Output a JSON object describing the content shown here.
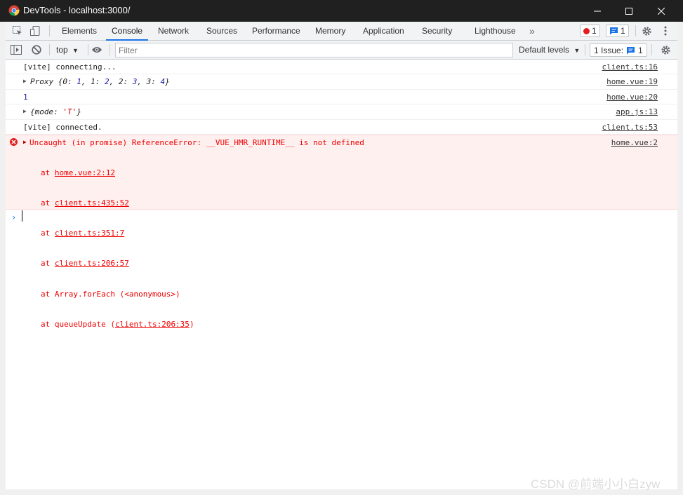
{
  "window": {
    "title": "DevTools - localhost:3000/"
  },
  "tabs": [
    {
      "label": "Elements"
    },
    {
      "label": "Console"
    },
    {
      "label": "Network"
    },
    {
      "label": "Sources"
    },
    {
      "label": "Performance"
    },
    {
      "label": "Memory"
    },
    {
      "label": "Application"
    },
    {
      "label": "Security"
    },
    {
      "label": "Lighthouse"
    }
  ],
  "tabbar": {
    "more": "»",
    "error_count": "1",
    "message_count": "1"
  },
  "toolbar": {
    "context": "top",
    "filter_placeholder": "Filter",
    "levels": "Default levels",
    "issues_label": "1 Issue:",
    "issues_count": "1"
  },
  "messages": [
    {
      "text": "[vite] connecting...",
      "source": "client.ts:16"
    },
    {
      "label": "Proxy",
      "source": "home.vue:19"
    },
    {
      "text": "1",
      "source": "home.vue:20"
    },
    {
      "source": "app.js:13"
    },
    {
      "text": "[vite] connected.",
      "source": "client.ts:53"
    }
  ],
  "proxy": {
    "open": "{",
    "k0": "0",
    "v0": "1",
    "k1": "1",
    "v1": "2",
    "k2": "2",
    "v2": "3",
    "k3": "3",
    "v3": "4",
    "close": "}"
  },
  "object": {
    "open": "{",
    "key": "mode",
    "value": "'T'",
    "close": "}"
  },
  "error": {
    "text": "Uncaught (in promise) ReferenceError: __VUE_HMR_RUNTIME__ is not defined",
    "source": "home.vue:2",
    "stack": [
      {
        "prefix": "at ",
        "link": "home.vue:2:12"
      },
      {
        "prefix": "at ",
        "link": "client.ts:435:52"
      },
      {
        "prefix": "at ",
        "link": "client.ts:351:7"
      },
      {
        "prefix": "at ",
        "link": "client.ts:206:57"
      },
      {
        "prefix": "at Array.forEach (<anonymous>)"
      },
      {
        "prefix": "at queueUpdate (",
        "link": "client.ts:206:35",
        "suffix": ")"
      }
    ]
  },
  "watermark": "CSDN @前端小小白zyw",
  "colors": {
    "accent": "#1a73e8",
    "error": "#e41e1e",
    "error_bg": "#fff0f0",
    "titlebar": "#202020"
  }
}
